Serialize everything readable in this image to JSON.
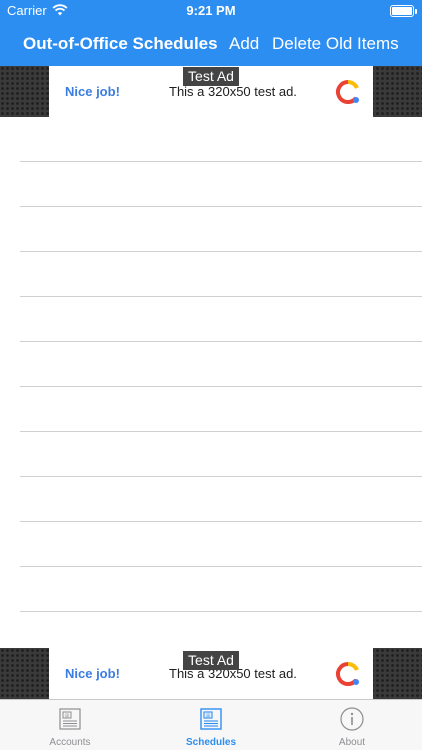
{
  "status_bar": {
    "carrier": "Carrier",
    "time": "9:21 PM"
  },
  "nav_bar": {
    "title": "Out-of-Office Schedules",
    "add_label": "Add",
    "delete_label": "Delete Old Items"
  },
  "ads": {
    "tag": "Test Ad",
    "headline": "Nice job!",
    "description": "This a 320x50 test ad."
  },
  "table": {
    "row_count": 11
  },
  "tab_bar": {
    "tabs": [
      {
        "label": "Accounts",
        "icon": "accounts-icon",
        "active": false
      },
      {
        "label": "Schedules",
        "icon": "schedules-icon",
        "active": true
      },
      {
        "label": "About",
        "icon": "info-icon",
        "active": false
      }
    ]
  },
  "colors": {
    "accent": "#2d8ef2",
    "inactive_tab": "#8e8e93",
    "ad_link": "#3b7de0"
  }
}
